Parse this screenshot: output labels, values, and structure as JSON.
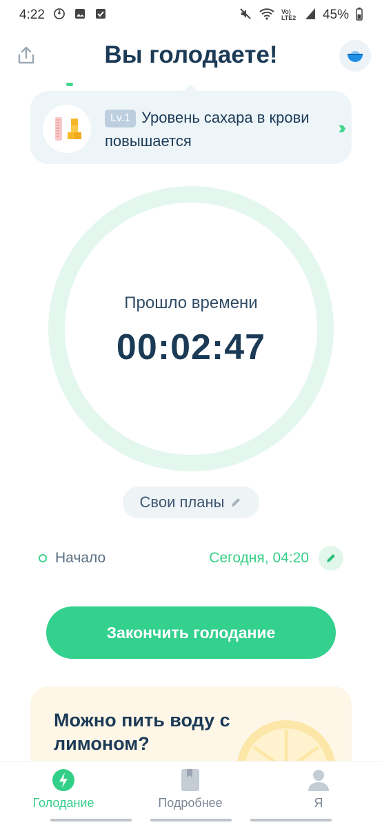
{
  "status_bar": {
    "time": "4:22",
    "network": "Vo) LTE2",
    "battery": "45%"
  },
  "header": {
    "title": "Вы голодаете!"
  },
  "stage": {
    "level": "Lv.1",
    "text": "Уровень сахара в крови повышается"
  },
  "timer": {
    "label": "Прошло времени",
    "elapsed": "00:02:47"
  },
  "plans": {
    "label": "Свои планы"
  },
  "start": {
    "label": "Начало",
    "value": "Сегодня, 04:20"
  },
  "end_button": {
    "label": "Закончить голодание"
  },
  "article": {
    "title": "Можно пить воду с лимоном?"
  },
  "nav": {
    "items": [
      {
        "label": "Голодание",
        "active": true
      },
      {
        "label": "Подробнее",
        "active": false
      },
      {
        "label": "Я",
        "active": false
      }
    ]
  },
  "colors": {
    "accent": "#34d08e",
    "title": "#1b3a56",
    "ring": "#e3f7ee"
  }
}
